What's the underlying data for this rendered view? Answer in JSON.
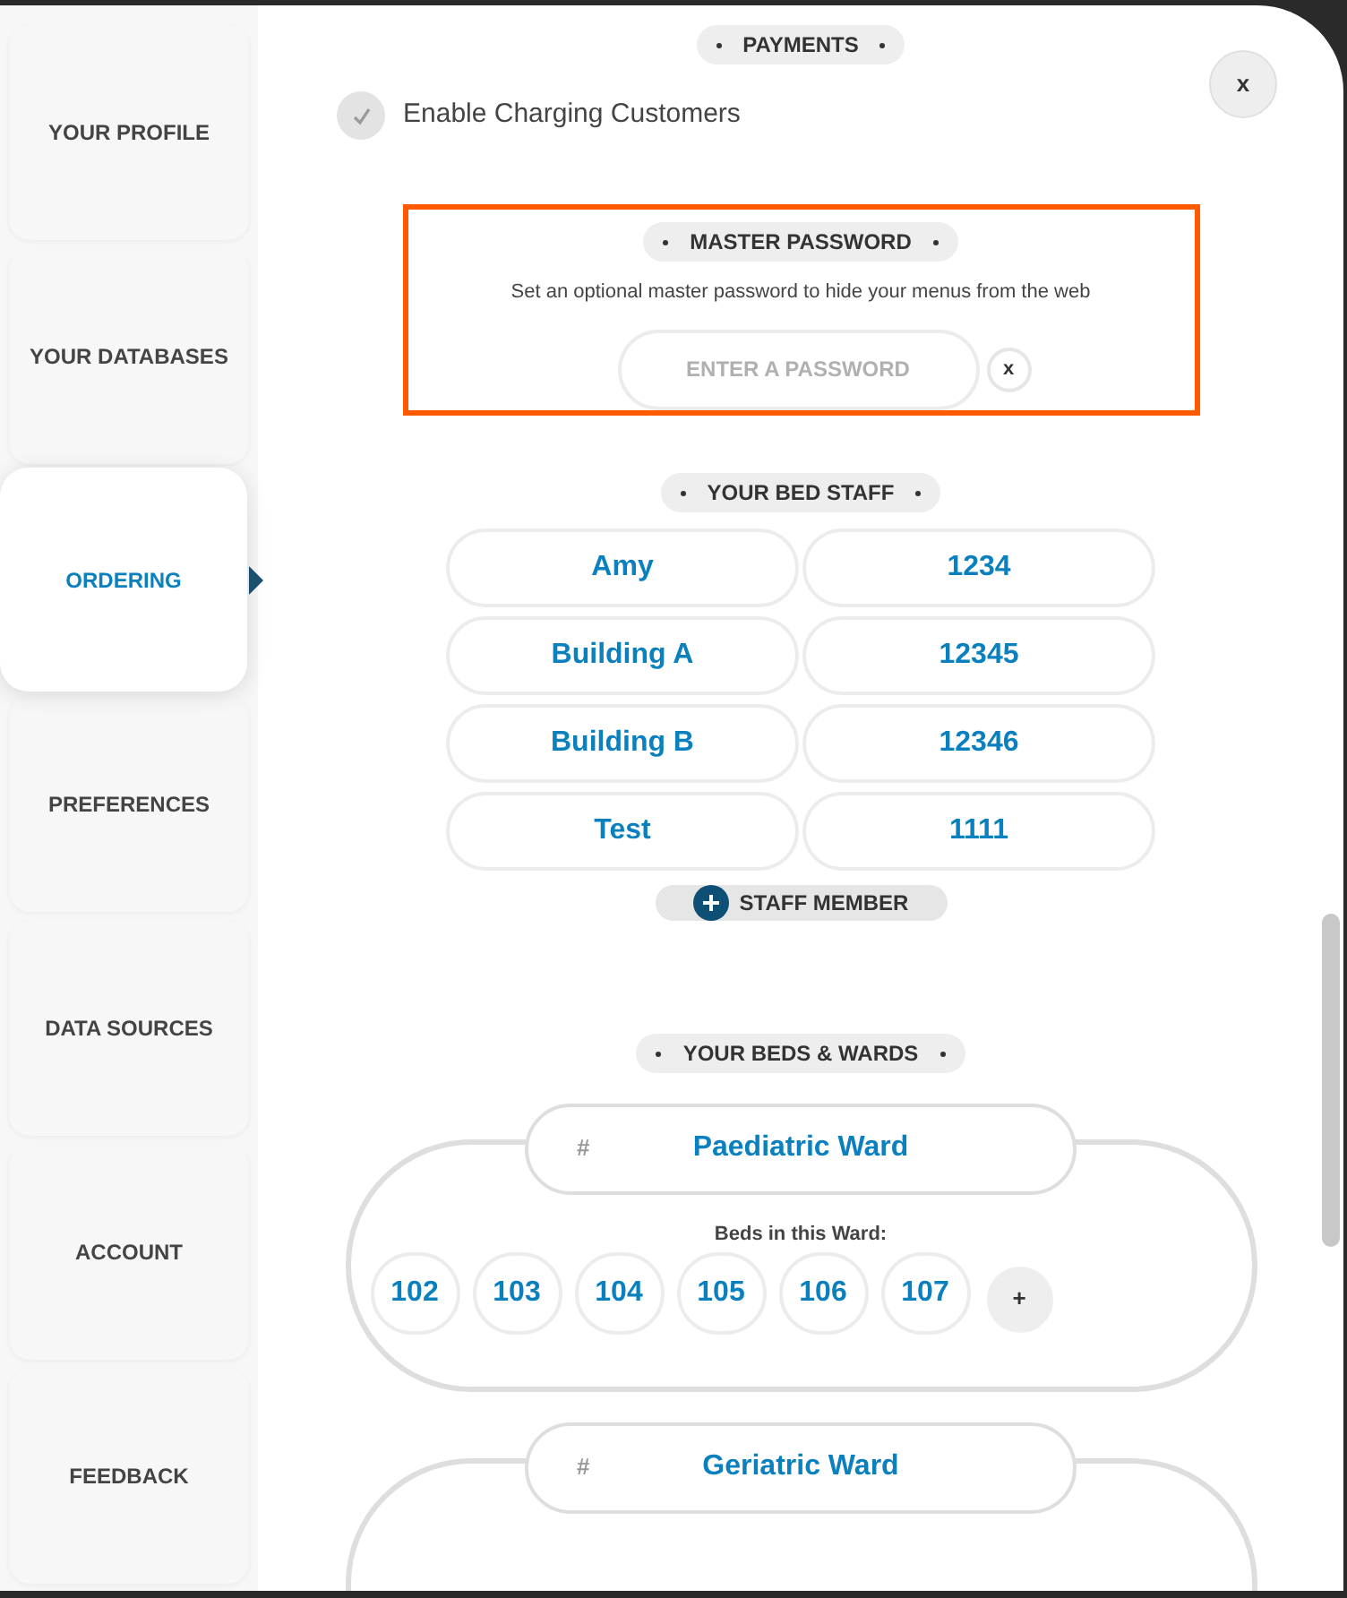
{
  "sidebar": {
    "items": [
      {
        "label": "YOUR PROFILE",
        "selected": false
      },
      {
        "label": "YOUR DATABASES",
        "selected": false
      },
      {
        "label": "ORDERING",
        "selected": true
      },
      {
        "label": "PREFERENCES",
        "selected": false
      },
      {
        "label": "DATA SOURCES",
        "selected": false
      },
      {
        "label": "ACCOUNT",
        "selected": false
      },
      {
        "label": "FEEDBACK",
        "selected": false
      }
    ]
  },
  "close_button": {
    "label": "x"
  },
  "payments": {
    "heading": "PAYMENTS",
    "option": {
      "label": "Enable Charging Customers",
      "checked": true
    }
  },
  "master_password": {
    "heading": "MASTER PASSWORD",
    "highlighted": true,
    "description": "Set an optional master password to hide your menus from the web",
    "placeholder": "ENTER A PASSWORD",
    "clear_button": "x"
  },
  "bed_staff": {
    "heading": "YOUR BED STAFF",
    "members": [
      {
        "name": "Amy",
        "code": "1234"
      },
      {
        "name": "Building A",
        "code": "12345"
      },
      {
        "name": "Building B",
        "code": "12346"
      },
      {
        "name": "Test",
        "code": "1111"
      }
    ],
    "add_button": "STAFF MEMBER"
  },
  "beds_wards": {
    "heading": "YOUR BEDS & WARDS",
    "wards": [
      {
        "number": "#",
        "name": "Paediatric Ward",
        "beds_label": "Beds in this Ward:",
        "beds": [
          "102",
          "103",
          "104",
          "105",
          "106",
          "107"
        ],
        "add_bed": "+"
      },
      {
        "number": "#",
        "name": "Geriatric Ward"
      }
    ]
  }
}
